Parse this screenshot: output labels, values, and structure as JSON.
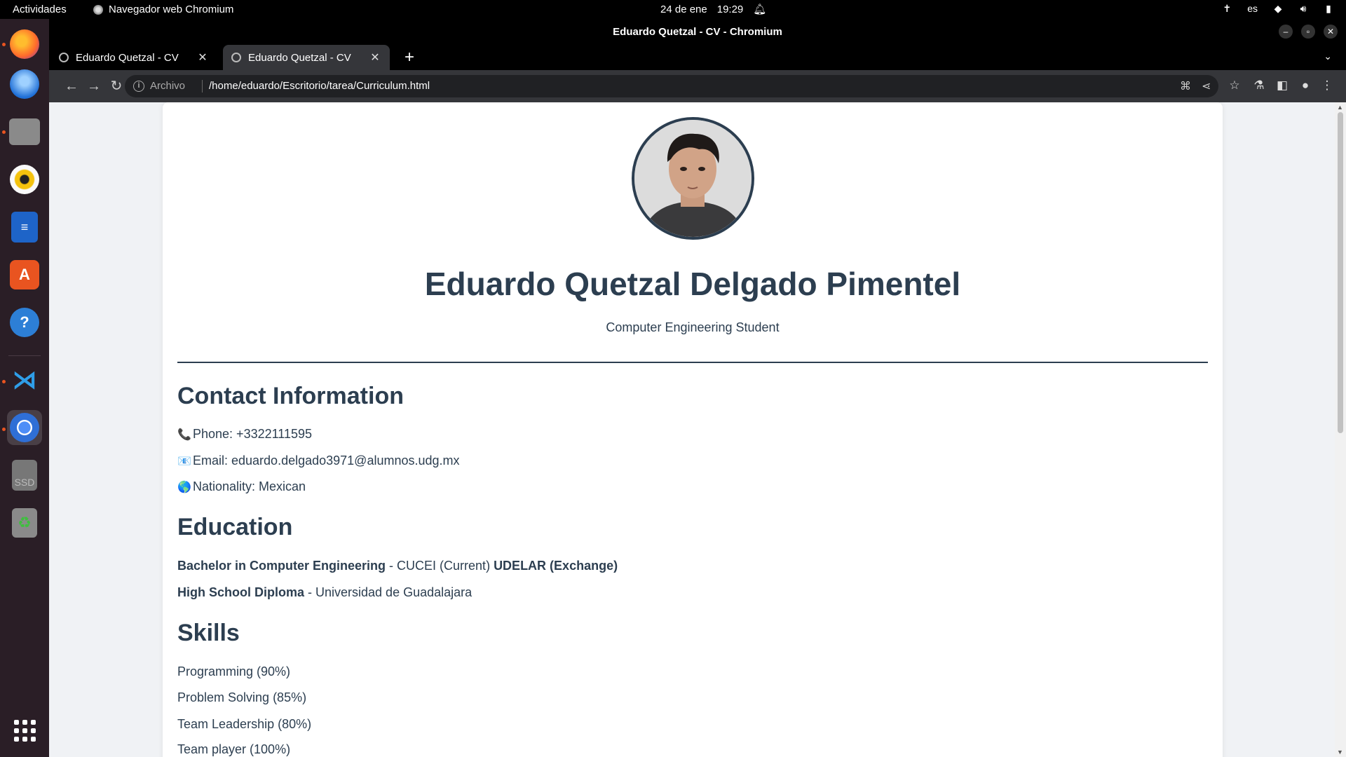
{
  "topbar": {
    "activities": "Actividades",
    "app_name": "Navegador web Chromium",
    "date": "24 de ene",
    "time": "19:29",
    "lang": "es"
  },
  "window": {
    "title": "Eduardo Quetzal - CV - Chromium"
  },
  "tabs": [
    {
      "label": "Eduardo Quetzal - CV"
    },
    {
      "label": "Eduardo Quetzal - CV"
    }
  ],
  "omnibox": {
    "scheme": "Archivo",
    "url": "/home/eduardo/Escritorio/tarea/Curriculum.html"
  },
  "cv": {
    "name": "Eduardo Quetzal Delgado Pimentel",
    "role": "Computer Engineering Student",
    "contact_heading": "Contact Information",
    "phone": "Phone: +3322111595",
    "email": "Email: eduardo.delgado3971@alumnos.udg.mx",
    "nationality": "Nationality: Mexican",
    "education_heading": "Education",
    "edu1_title": "Bachelor in Computer Engineering",
    "edu1_rest": " - CUCEI (Current) ",
    "edu1_extra": "UDELAR (Exchange)",
    "edu2_title": "High School Diploma",
    "edu2_rest": " - Universidad de Guadalajara",
    "skills_heading": "Skills",
    "skills": [
      "Programming (90%)",
      "Problem Solving (85%)",
      "Team Leadership (80%)",
      "Team player (100%)"
    ]
  },
  "colors": {
    "heading": "#2c3e50",
    "page_bg": "#f0f2f5",
    "accent_dock": "#e95420"
  }
}
